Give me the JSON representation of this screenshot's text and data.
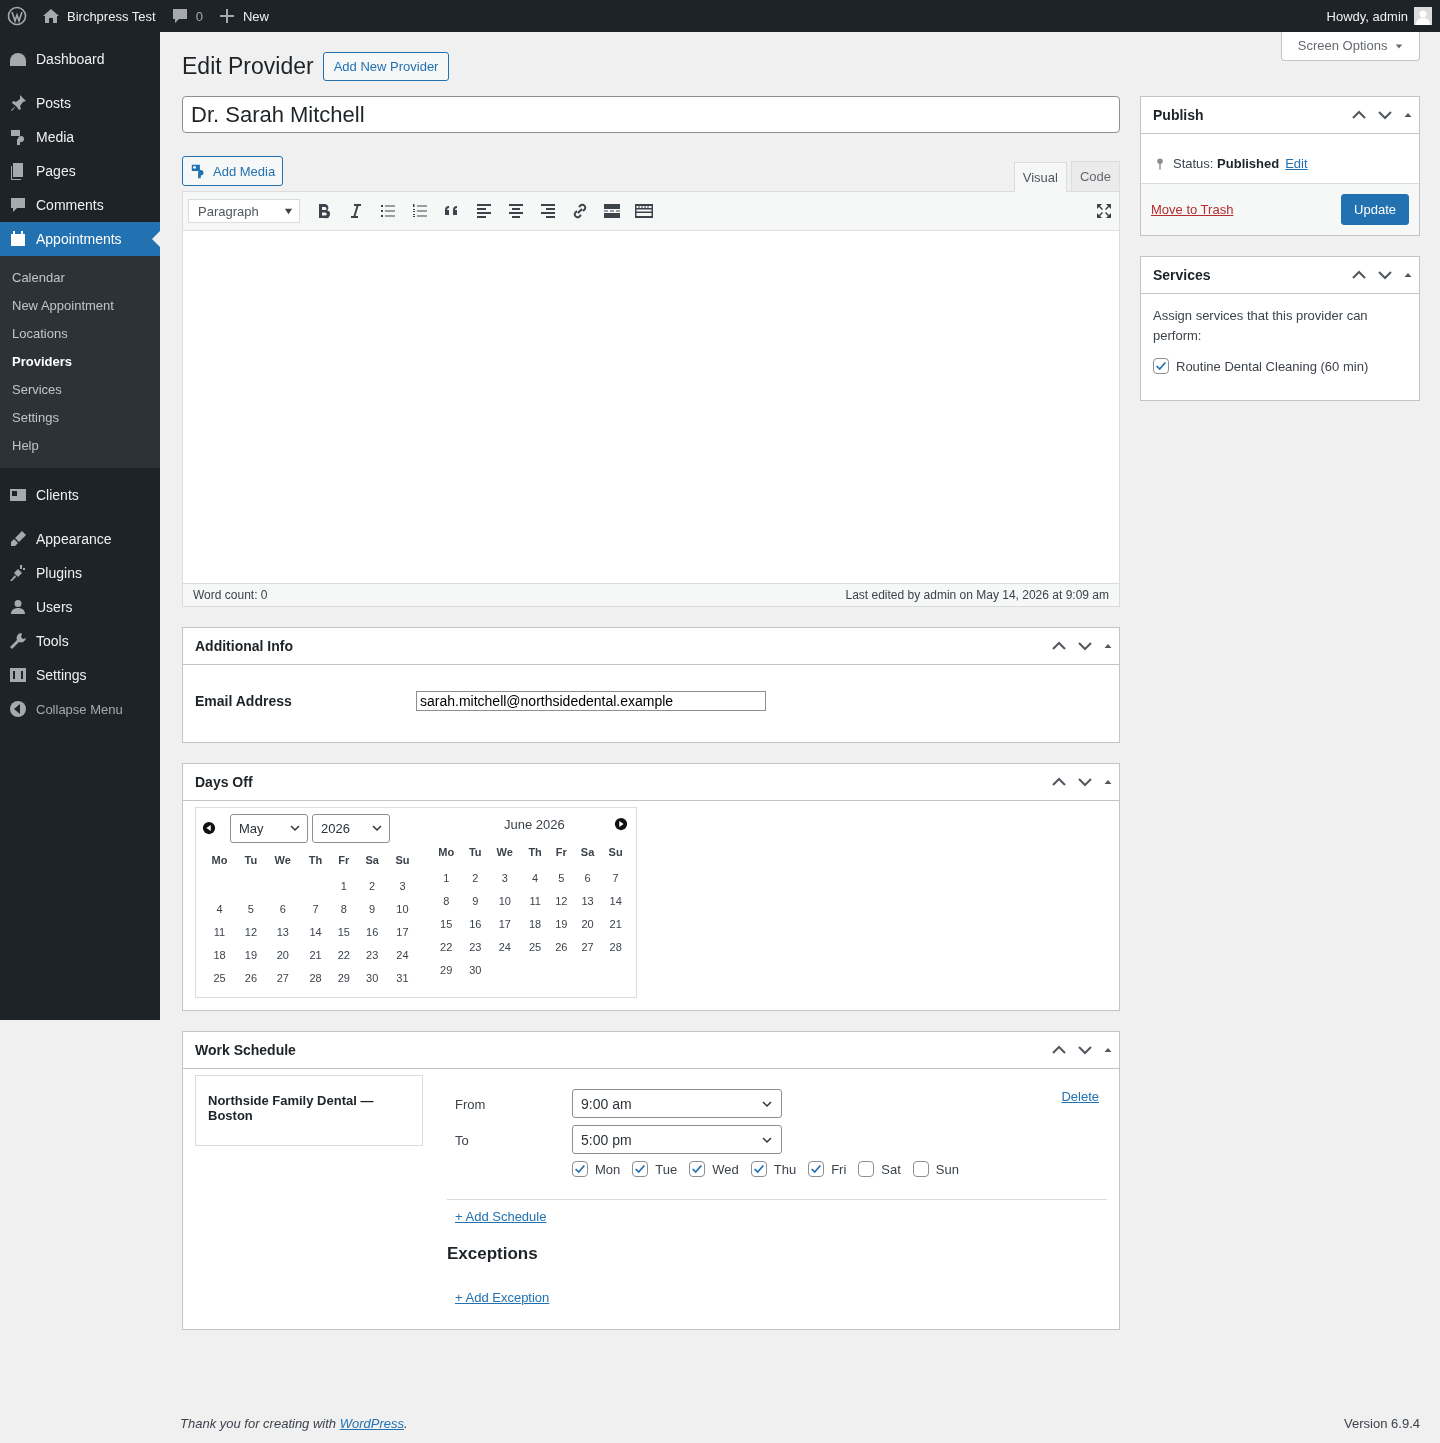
{
  "admin_bar": {
    "site": "Birchpress Test",
    "comments": "0",
    "new": "New",
    "greeting": "Howdy, admin"
  },
  "sidebar": {
    "items": [
      {
        "label": "Dashboard",
        "selected": false
      },
      {
        "label": "Posts",
        "selected": false
      },
      {
        "label": "Media",
        "selected": false
      },
      {
        "label": "Pages",
        "selected": false
      },
      {
        "label": "Comments",
        "selected": false
      },
      {
        "label": "Appointments",
        "selected": true,
        "children": [
          {
            "label": "Calendar",
            "selected": false
          },
          {
            "label": "New Appointment",
            "selected": false
          },
          {
            "label": "Locations",
            "selected": false
          },
          {
            "label": "Providers",
            "selected": true
          },
          {
            "label": "Services",
            "selected": false
          },
          {
            "label": "Settings",
            "selected": false
          },
          {
            "label": "Help",
            "selected": false
          }
        ]
      },
      {
        "label": "Clients",
        "selected": false
      },
      {
        "label": "Appearance",
        "selected": false
      },
      {
        "label": "Plugins",
        "selected": false
      },
      {
        "label": "Users",
        "selected": false
      },
      {
        "label": "Tools",
        "selected": false
      },
      {
        "label": "Settings",
        "selected": false
      }
    ],
    "collapse": "Collapse Menu"
  },
  "header": {
    "title": "Edit Provider",
    "add_new": "Add New Provider",
    "screen_options": "Screen Options"
  },
  "post_title": "Dr. Sarah Mitchell",
  "editor": {
    "add_media": "Add Media",
    "tabs": [
      {
        "label": "Visual",
        "selected": true
      },
      {
        "label": "Code",
        "selected": false
      }
    ],
    "format": "Paragraph",
    "word_count": "Word count: 0",
    "last_edited": "Last edited by admin on May 14, 2026 at 9:09 am"
  },
  "additional_info": {
    "title": "Additional Info",
    "email_label": "Email Address",
    "email_value": "sarah.mitchell@northsidedental.example"
  },
  "days_off": {
    "title": "Days Off",
    "month_select": "May",
    "year_select": "2026",
    "second_month": "June 2026",
    "weekdays": [
      "Mo",
      "Tu",
      "We",
      "Th",
      "Fr",
      "Sa",
      "Su"
    ],
    "first_weeks": [
      [
        "1",
        "2",
        "3"
      ],
      [
        "4",
        "5",
        "6",
        "7",
        "8",
        "9",
        "10"
      ],
      [
        "11",
        "12",
        "13",
        "14",
        "15",
        "16",
        "17"
      ],
      [
        "18",
        "19",
        "20",
        "21",
        "22",
        "23",
        "24"
      ],
      [
        "25",
        "26",
        "27",
        "28",
        "29",
        "30",
        "31"
      ]
    ],
    "second_weekdays": [
      "Mo",
      "Tu",
      "We",
      "Th",
      "Fr",
      "Sa",
      "Su"
    ],
    "second_weeks": [
      [
        "1",
        "2",
        "3",
        "4",
        "5",
        "6",
        "7"
      ],
      [
        "8",
        "9",
        "10",
        "11",
        "12",
        "13",
        "14"
      ],
      [
        "15",
        "16",
        "17",
        "18",
        "19",
        "20",
        "21"
      ],
      [
        "22",
        "23",
        "24",
        "25",
        "26",
        "27",
        "28"
      ],
      [
        "29",
        "30"
      ]
    ]
  },
  "work_schedule": {
    "title": "Work Schedule",
    "location": "Northside Family Dental — Boston",
    "from_label": "From",
    "from_value": "9:00 am",
    "to_label": "To",
    "to_value": "5:00 pm",
    "delete": "Delete",
    "days": [
      {
        "label": "Mon",
        "checked": true
      },
      {
        "label": "Tue",
        "checked": true
      },
      {
        "label": "Wed",
        "checked": true
      },
      {
        "label": "Thu",
        "checked": true
      },
      {
        "label": "Fri",
        "checked": true
      },
      {
        "label": "Sat",
        "checked": false
      },
      {
        "label": "Sun",
        "checked": false
      }
    ],
    "add_schedule": "+ Add Schedule",
    "exceptions_title": "Exceptions",
    "add_exception": "+ Add Exception"
  },
  "publish": {
    "title": "Publish",
    "status_label": "Status:",
    "status_value": "Published",
    "edit": "Edit",
    "trash": "Move to Trash",
    "update": "Update"
  },
  "services": {
    "title": "Services",
    "description": "Assign services that this provider can perform:",
    "items": [
      {
        "label": "Routine Dental Cleaning (60 min)",
        "checked": true
      }
    ]
  },
  "footer": {
    "thanks": "Thank you for creating with",
    "link": "WordPress",
    "suffix": ".",
    "version": "Version 6.9.4"
  }
}
